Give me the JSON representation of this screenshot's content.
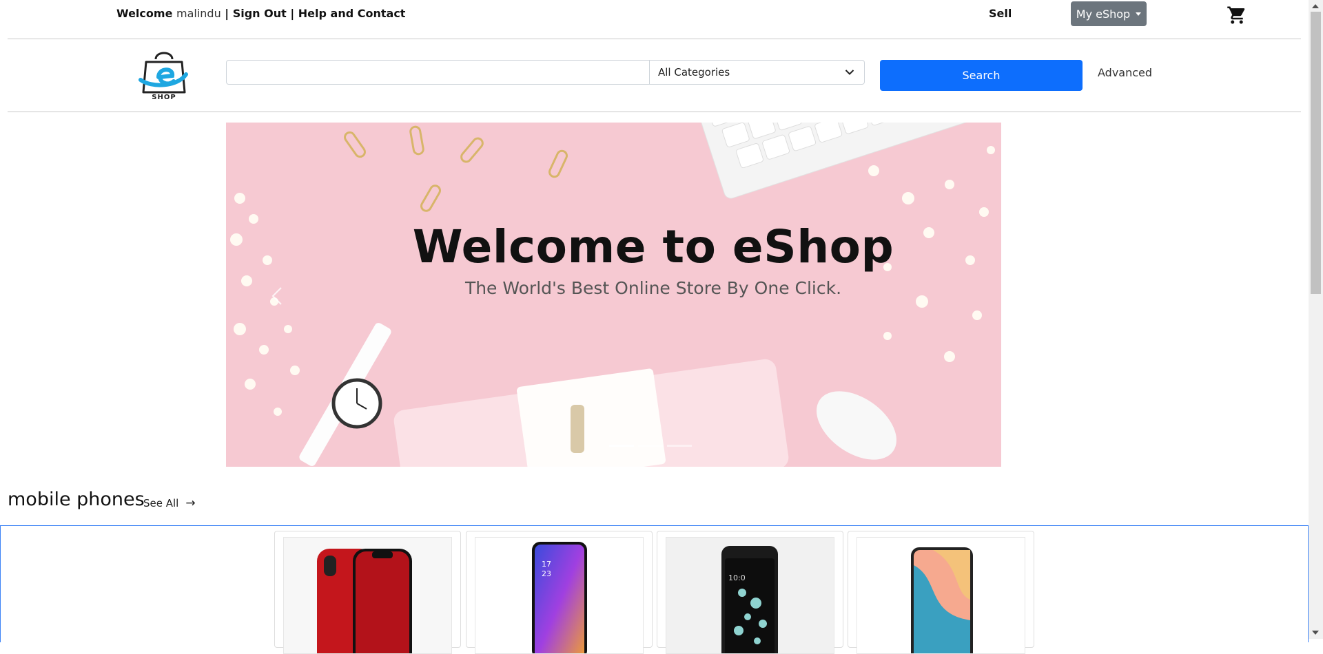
{
  "topbar": {
    "welcome_prefix": "Welcome",
    "username": "malindu",
    "sep1": "|",
    "sign_out": "Sign Out",
    "sep2": "|",
    "help_contact": "Help and Contact",
    "sell": "Sell",
    "my_eshop": "My eShop"
  },
  "logo": {
    "text": "SHOP"
  },
  "search": {
    "input_value": "",
    "category_selected": "All Categories",
    "search_button": "Search",
    "advanced": "Advanced"
  },
  "banner": {
    "title": "Welcome to eShop",
    "subtitle": "The World's Best Online Store By One Click.",
    "slides": 3,
    "active_slide": 1
  },
  "section": {
    "title": "mobile phones",
    "see_all": "See All",
    "arrow": "→"
  },
  "products": [
    {
      "name": "red-iphone-xr"
    },
    {
      "name": "purple-android-phone"
    },
    {
      "name": "black-htc-phone"
    },
    {
      "name": "pastel-android-phone"
    }
  ],
  "colors": {
    "primary": "#0d6efd",
    "secondary": "#6c757d",
    "banner_bg": "#f6c9d2",
    "frame_border": "#3b82f6"
  }
}
